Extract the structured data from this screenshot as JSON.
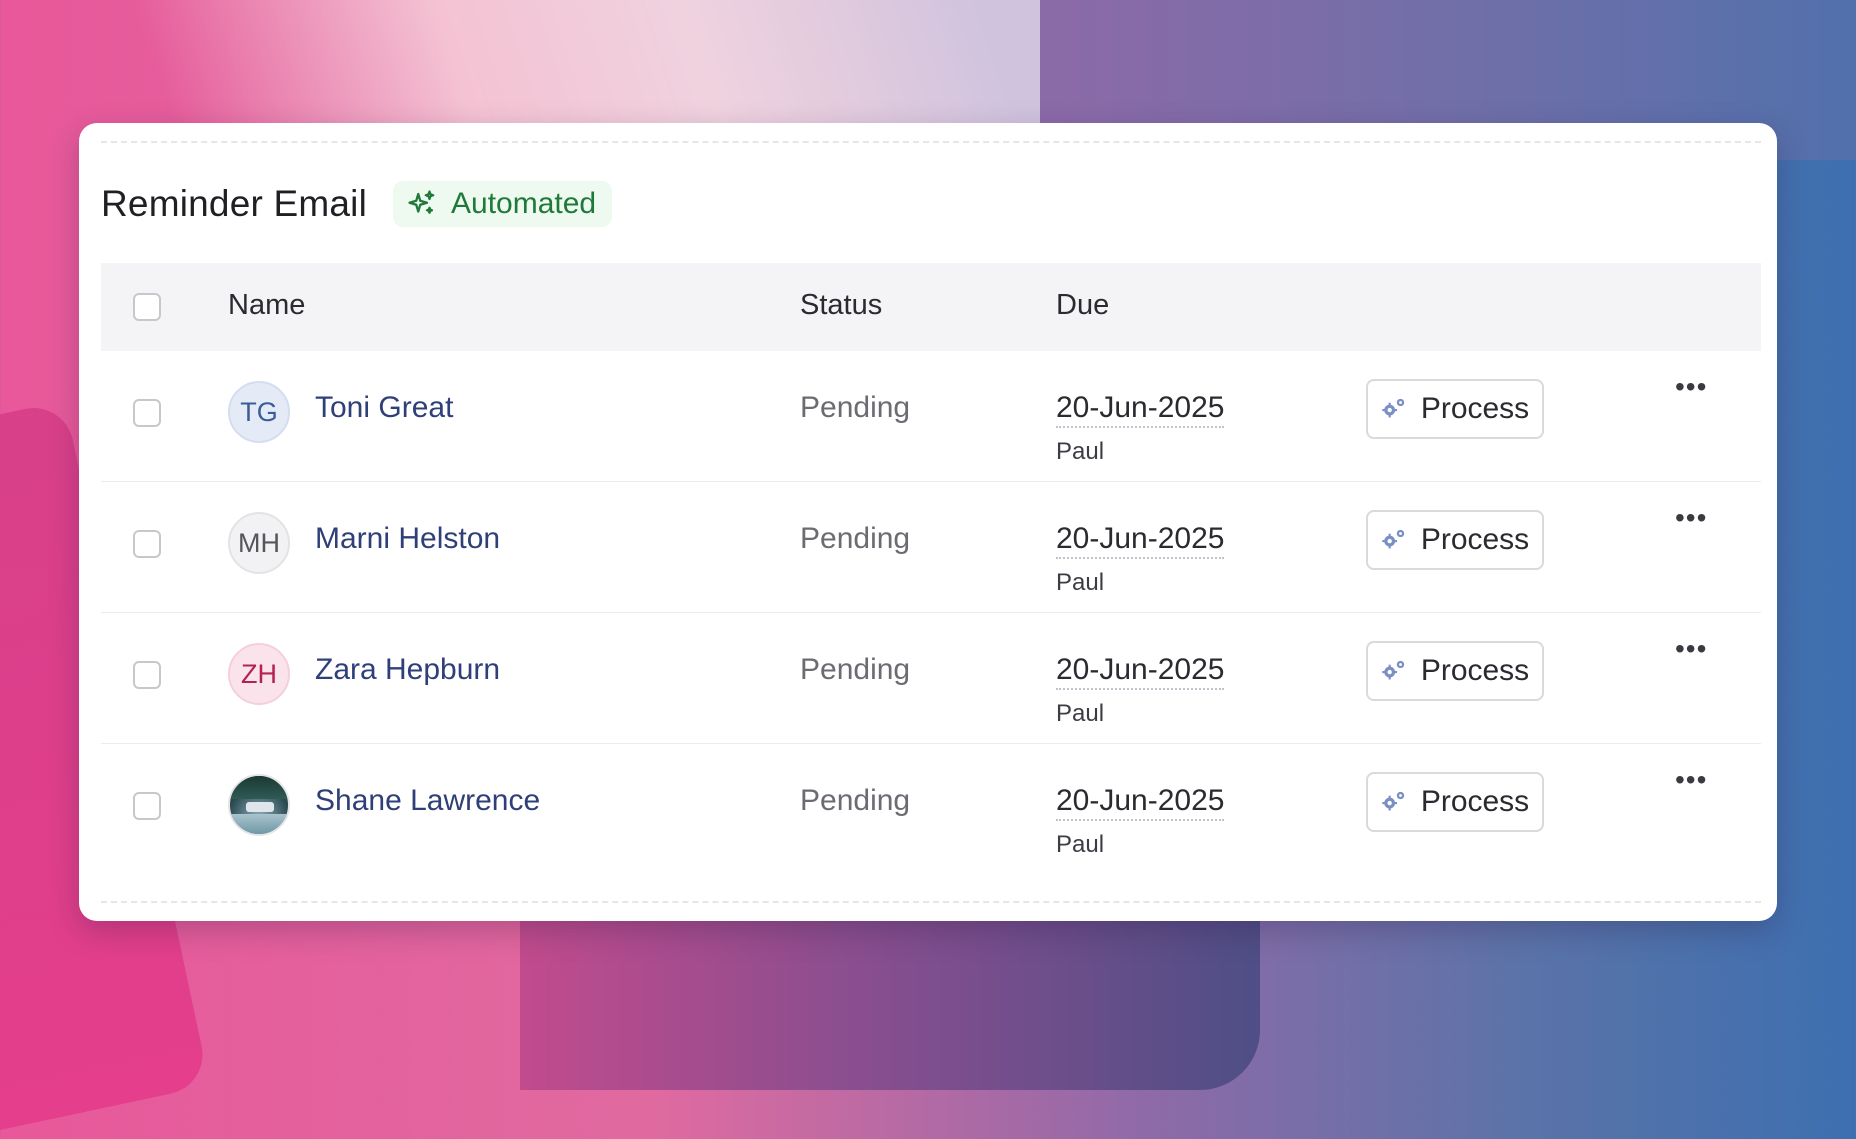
{
  "colors": {
    "accent_name": "#2f3f78",
    "badge_bg": "#eef9f0",
    "badge_text": "#1f7a3a"
  },
  "header": {
    "title": "Reminder Email",
    "badge": {
      "label": "Automated",
      "icon": "sparkles-icon"
    }
  },
  "table": {
    "columns": [
      "Name",
      "Status",
      "Due"
    ],
    "rows": [
      {
        "initials": "TG",
        "avatar_style": "blue",
        "name": "Toni Great",
        "status": "Pending",
        "due": "20-Jun-2025",
        "owner": "Paul",
        "action": "Process"
      },
      {
        "initials": "MH",
        "avatar_style": "grey",
        "name": "Marni Helston",
        "status": "Pending",
        "due": "20-Jun-2025",
        "owner": "Paul",
        "action": "Process"
      },
      {
        "initials": "ZH",
        "avatar_style": "pink",
        "name": "Zara Hepburn",
        "status": "Pending",
        "due": "20-Jun-2025",
        "owner": "Paul",
        "action": "Process"
      },
      {
        "initials": "",
        "avatar_style": "photo",
        "name": "Shane Lawrence",
        "status": "Pending",
        "due": "20-Jun-2025",
        "owner": "Paul",
        "action": "Process"
      }
    ]
  }
}
